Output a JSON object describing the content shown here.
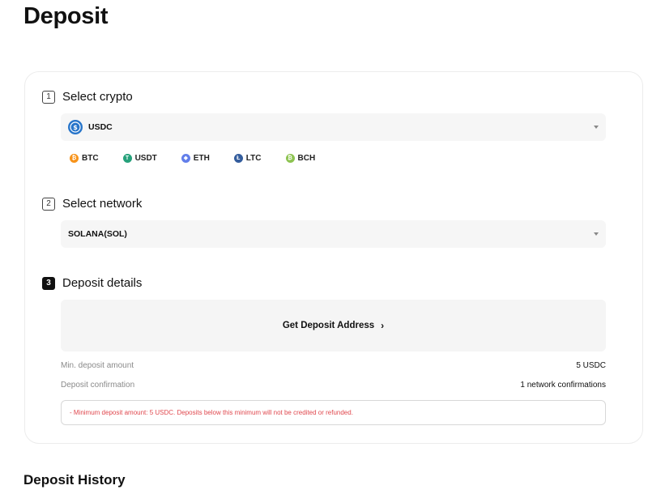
{
  "page": {
    "title": "Deposit"
  },
  "steps": [
    {
      "number": "1",
      "title": "Select crypto"
    },
    {
      "number": "2",
      "title": "Select network"
    },
    {
      "number": "3",
      "title": "Deposit details"
    }
  ],
  "crypto_select": {
    "value": "USDC",
    "icon": "usdc-icon"
  },
  "quick_coins": [
    {
      "label": "BTC",
      "icon": "btc-icon",
      "color": "#f7931a",
      "glyph": "₿"
    },
    {
      "label": "USDT",
      "icon": "usdt-icon",
      "color": "#26a17b",
      "glyph": "T"
    },
    {
      "label": "ETH",
      "icon": "eth-icon",
      "color": "#627eea",
      "glyph": "◆"
    },
    {
      "label": "LTC",
      "icon": "ltc-icon",
      "color": "#345d9d",
      "glyph": "Ł"
    },
    {
      "label": "BCH",
      "icon": "bch-icon",
      "color": "#8dc351",
      "glyph": "₿"
    }
  ],
  "network_select": {
    "value": "SOLANA(SOL)"
  },
  "deposit_details": {
    "get_address_label": "Get Deposit Address",
    "min_amount_label": "Min. deposit amount",
    "min_amount_value": "5 USDC",
    "confirmation_label": "Deposit confirmation",
    "confirmation_value": "1 network confirmations",
    "notice": "- Minimum deposit amount: 5 USDC. Deposits below this minimum will not be credited or refunded."
  },
  "history": {
    "title": "Deposit History"
  },
  "colors": {
    "accent": "#111111",
    "warning": "#e0484e",
    "usdc": "#2775ca"
  }
}
